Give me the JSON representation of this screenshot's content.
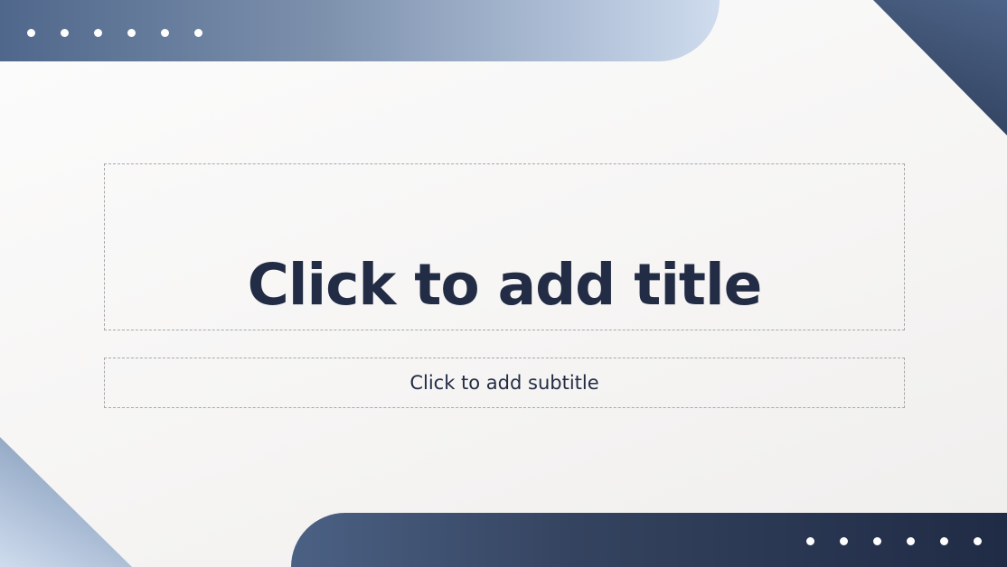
{
  "slide": {
    "title_placeholder": "Click to add title",
    "subtitle_placeholder": "Click to add subtitle"
  },
  "colors": {
    "title_text": "#232c45",
    "background": "#f6f5f4",
    "accent_dark": "#202b45",
    "accent_mid": "#4f678b",
    "accent_light": "#cfdcee",
    "placeholder_border": "#a9a9a9"
  }
}
